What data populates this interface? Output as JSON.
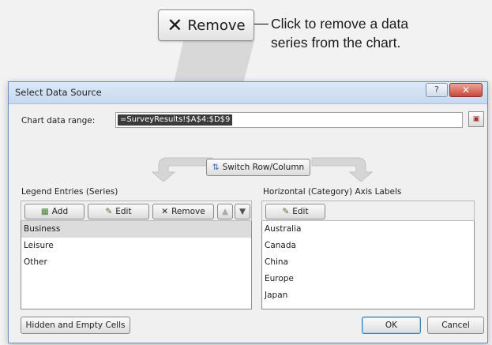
{
  "callout": {
    "button_label": "Remove",
    "button_icon": "close-x-icon",
    "text_line1": "Click to remove a data",
    "text_line2": "series from the chart."
  },
  "dialog": {
    "title": "Select Data Source",
    "help_label": "?",
    "close_label": "✕",
    "chart_range_label": "Chart data range:",
    "chart_range_value": "=SurveyResults!$A$4:$D$9",
    "switch_label": "Switch Row/Column",
    "legend": {
      "heading": "Legend Entries (Series)",
      "add_label": "Add",
      "edit_label": "Edit",
      "remove_label": "Remove",
      "items": [
        "Business",
        "Leisure",
        "Other"
      ],
      "selected_index": 0
    },
    "axis": {
      "heading": "Horizontal (Category) Axis Labels",
      "edit_label": "Edit",
      "items": [
        "Australia",
        "Canada",
        "China",
        "Europe",
        "Japan"
      ]
    },
    "hidden_empty_label": "Hidden and Empty Cells",
    "ok_label": "OK",
    "cancel_label": "Cancel"
  },
  "colors": {
    "titlebar": "#c7d9ef",
    "close": "#c9473a",
    "selection": "#dcdcdc"
  }
}
